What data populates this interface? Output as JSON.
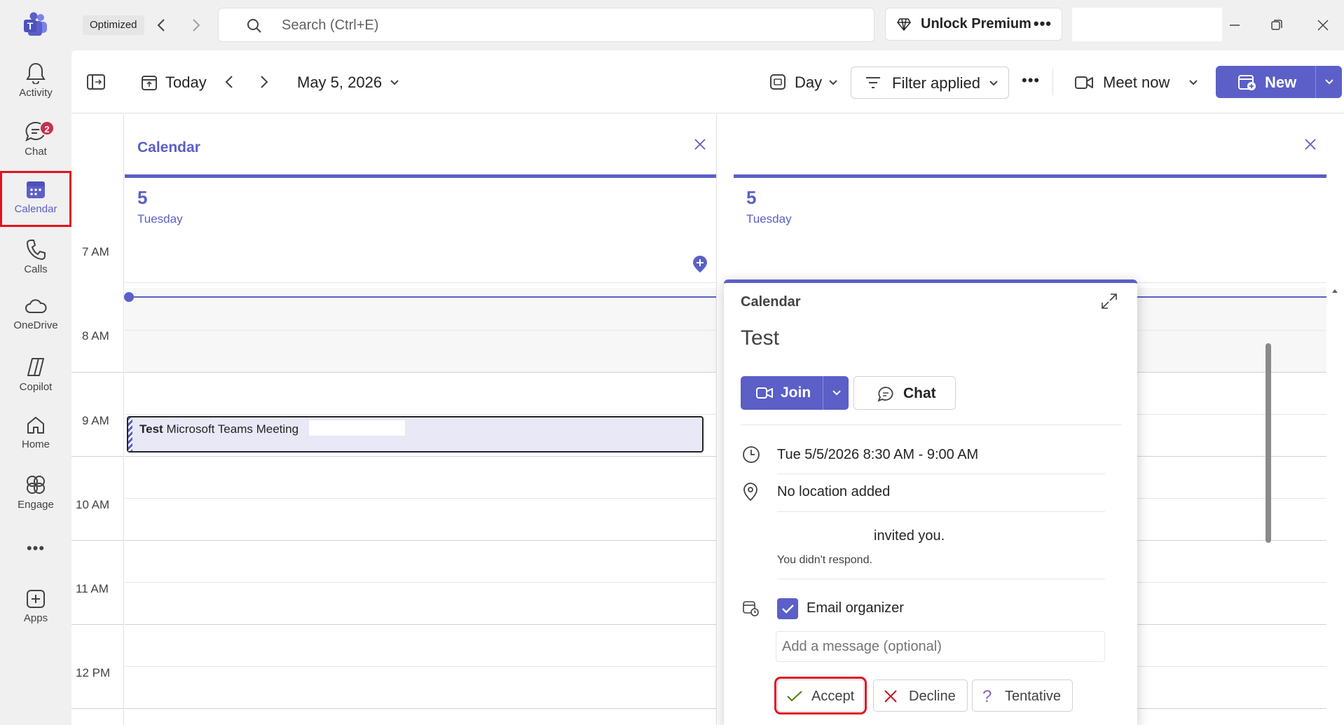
{
  "titlebar": {
    "mode_label": "Optimized",
    "search_placeholder": "Search (Ctrl+E)",
    "premium_label": "Unlock Premium",
    "more_label": "•••"
  },
  "rail": {
    "items": [
      {
        "label": "Activity",
        "icon": "bell-icon"
      },
      {
        "label": "Chat",
        "icon": "chat-icon",
        "badge": "2"
      },
      {
        "label": "Calendar",
        "icon": "calendar-icon"
      },
      {
        "label": "Calls",
        "icon": "phone-icon"
      },
      {
        "label": "OneDrive",
        "icon": "cloud-icon"
      },
      {
        "label": "Copilot",
        "icon": "copilot-icon"
      },
      {
        "label": "Home",
        "icon": "home-icon"
      },
      {
        "label": "Engage",
        "icon": "engage-icon"
      },
      {
        "label": "",
        "icon": "more-icon"
      },
      {
        "label": "Apps",
        "icon": "apps-icon"
      }
    ],
    "more_dots": "•••"
  },
  "toolbar": {
    "today_label": "Today",
    "date_label": "May 5, 2026",
    "view_label": "Day",
    "filter_label": "Filter applied",
    "more_label": "•••",
    "meet_now_label": "Meet now",
    "new_label": "New"
  },
  "calendar": {
    "hours": [
      "7 AM",
      "8 AM",
      "9 AM",
      "10 AM",
      "11 AM",
      "12 PM"
    ],
    "columns": [
      {
        "title": "Calendar",
        "day_number": "5",
        "day_name": "Tuesday"
      },
      {
        "title": "",
        "day_number": "5",
        "day_name": "Tuesday"
      }
    ],
    "event": {
      "title": "Test",
      "subtitle": "Microsoft Teams Meeting"
    }
  },
  "popup": {
    "header": "Calendar",
    "title": "Test",
    "join_label": "Join",
    "chat_label": "Chat",
    "datetime": "Tue 5/5/2026 8:30 AM - 9:00 AM",
    "location": "No location added",
    "invited_text": "invited you.",
    "response_status": "You didn't respond.",
    "email_organizer_label": "Email organizer",
    "message_placeholder": "Add a message (optional)",
    "accept_label": "Accept",
    "decline_label": "Decline",
    "tentative_label": "Tentative"
  },
  "colors": {
    "brand": "#5b5fc7",
    "highlight": "#e3121f",
    "badge": "#c4314b",
    "accept": "#498205",
    "decline": "#c50f1f",
    "tentative": "#8764b8"
  }
}
